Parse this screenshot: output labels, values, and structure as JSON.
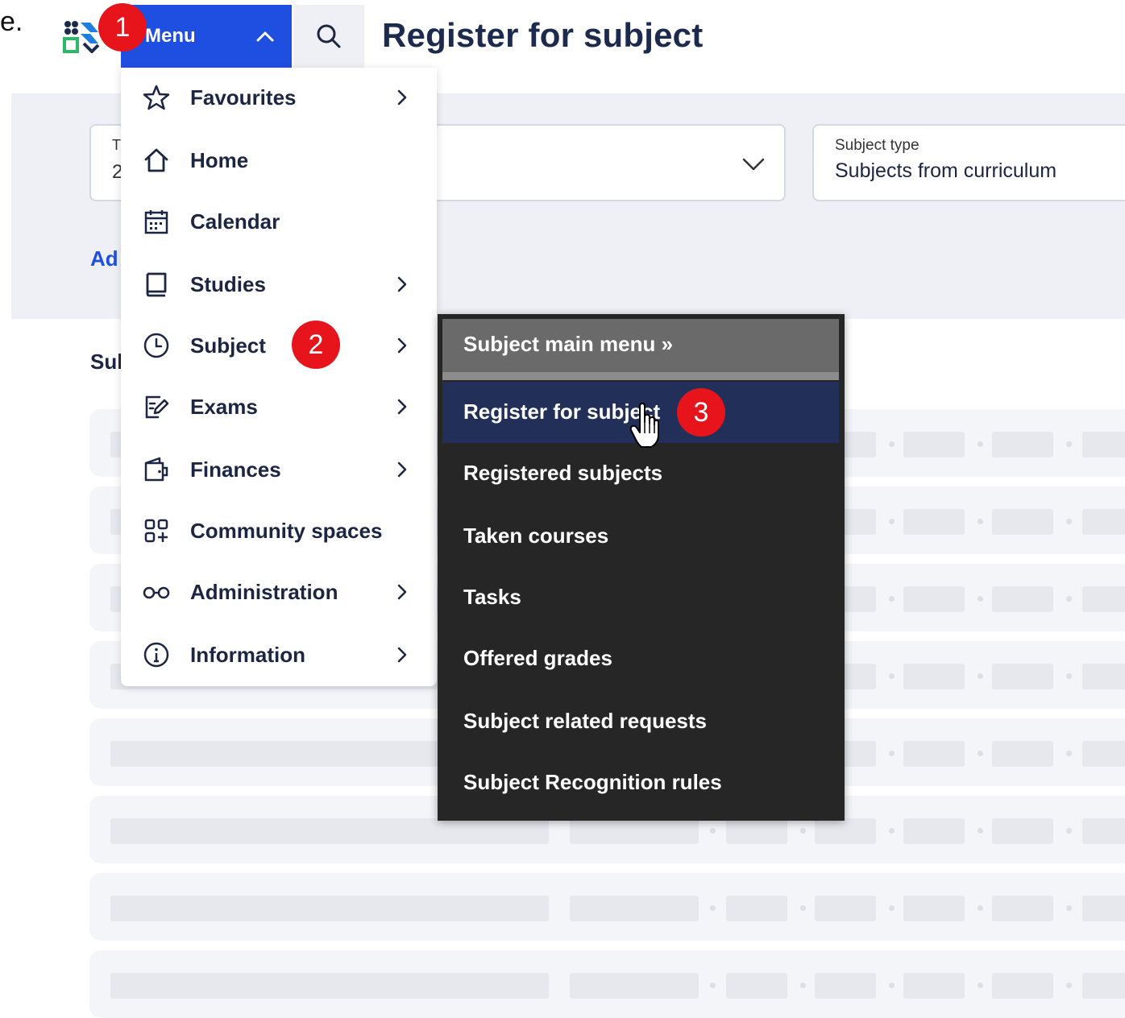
{
  "stray_text": "e.",
  "header": {
    "menu_label": "Menu",
    "page_title": "Register for subject"
  },
  "filters": {
    "term_label": "T",
    "term_value": "2",
    "subject_type_label": "Subject type",
    "subject_type_value": "Subjects from curriculum"
  },
  "add_link": "Ad",
  "section_heading": "Sul",
  "main_menu": {
    "items": [
      {
        "label": "Favourites",
        "icon": "star-icon",
        "has_submenu": true
      },
      {
        "label": "Home",
        "icon": "home-icon",
        "has_submenu": false
      },
      {
        "label": "Calendar",
        "icon": "calendar-icon",
        "has_submenu": false
      },
      {
        "label": "Studies",
        "icon": "book-icon",
        "has_submenu": true
      },
      {
        "label": "Subject",
        "icon": "clock-icon",
        "has_submenu": true
      },
      {
        "label": "Exams",
        "icon": "edit-icon",
        "has_submenu": true
      },
      {
        "label": "Finances",
        "icon": "wallet-icon",
        "has_submenu": true
      },
      {
        "label": "Community spaces",
        "icon": "grid-plus-icon",
        "has_submenu": false
      },
      {
        "label": "Administration",
        "icon": "glasses-icon",
        "has_submenu": true
      },
      {
        "label": "Information",
        "icon": "info-icon",
        "has_submenu": true
      }
    ]
  },
  "submenu": {
    "header": "Subject main menu »",
    "items": [
      {
        "label": "Register for subject",
        "active": true
      },
      {
        "label": "Registered subjects",
        "active": false
      },
      {
        "label": "Taken courses",
        "active": false
      },
      {
        "label": "Tasks",
        "active": false
      },
      {
        "label": "Offered grades",
        "active": false
      },
      {
        "label": "Subject related requests",
        "active": false
      },
      {
        "label": "Subject Recognition rules",
        "active": false
      }
    ]
  },
  "callouts": [
    "1",
    "2",
    "3"
  ],
  "colors": {
    "primary": "#1f4fe0",
    "submenu_bg": "#262626",
    "submenu_active": "#223059",
    "badge": "#e8141c"
  }
}
